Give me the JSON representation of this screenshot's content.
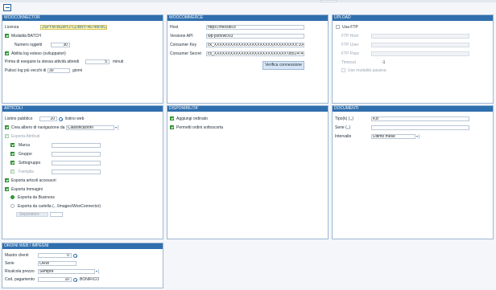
{
  "top": {
    "title": ""
  },
  "woo": {
    "header": "WOOCONNECTOR",
    "licenza_label": "Licenza",
    "licenza_value": "JSPYM-BGMY2-CDBNY-4674M-BCY28",
    "batch_label": "Modalità BATCH",
    "numero_label": "Numero oggetti",
    "numero_value": "30",
    "log_label": "Abilita log esteso (sviluppatori)",
    "attesa_label": "Prima di eseguire la stessa attività attendi",
    "attesa_value": "5",
    "attesa_unit": "minuti",
    "pulisci_label": "Pulisci log più vecchi di",
    "pulisci_value": "30",
    "pulisci_unit": "giorni"
  },
  "wc": {
    "header": "WOOCOMMERCE",
    "host_label": "Host",
    "host_value": "https://miosito.it",
    "api_label": "Versione API",
    "api_value": "wp-json/wc/v3",
    "ckey_label": "Consumer Key",
    "ckey_value": "ck_XXXXXXXXXXXXXXXXXXXXXXXXXXXXXXX:104986bbf",
    "csecret_label": "Consumer Secret",
    "csecret_value": "cs_XXXXXXXXXXXXXXXXXXXXXXXXXXX:0b5147451c5",
    "verify_button": "Verifica connessione"
  },
  "upload": {
    "header": "UPLOAD",
    "ftp_label": "Usa FTP",
    "host_label": "FTP Host",
    "user_label": "FTP User",
    "pass_label": "FTP Pass",
    "timeout_label": "Timeout",
    "timeout_value": "-1",
    "passive_label": "Use modalità passiva"
  },
  "articoli": {
    "header": "ARTICOLI",
    "listino_label": "Listino pubblico",
    "listino_value": "20",
    "listino_name": "listino web",
    "albero_label": "Crea albero di navigazione da",
    "albero_value": "Classificazioni",
    "attributi_label": "Esporta Attributi",
    "marca_label": "Marca",
    "gruppo_label": "Gruppo",
    "sottogruppo_label": "Sottogruppo",
    "famiglia_label": "Famiglia",
    "accessori_label": "Esporta articoli accessori",
    "immagini_label": "Esporta Immagini",
    "radio_business": "Esporta da Business",
    "radio_cartella": "Esporta da cartella (...\\Images\\WooConnector)",
    "separatore_label": "Separatore"
  },
  "disp": {
    "header": "DISPONIBILITA'",
    "aggiungi_label": "Aggiungi ordinato",
    "permetti_label": "Permetti ordini sottoscorta"
  },
  "doc": {
    "header": "DOCUMENTI",
    "tipo_label": "Tipo(k) (,,)",
    "tipo_value": "e,b",
    "serie_label": "Serie (,,)",
    "intervallo_label": "Intervallo",
    "intervallo_value": "Ultimo mese"
  },
  "ordini": {
    "header": "ORDINI WEB / IMPEGNI",
    "mastro_label": "Mastro clienti",
    "mastro_value": "0",
    "serie_label": "Serie",
    "serie_value": "ORW",
    "ricalcola_label": "Ricalcola prezzo",
    "ricalcola_value": "Sempre",
    "pagamento_label": "Cod. pagamento",
    "pagamento_value": "10",
    "pagamento_name": "BONIFICO"
  }
}
